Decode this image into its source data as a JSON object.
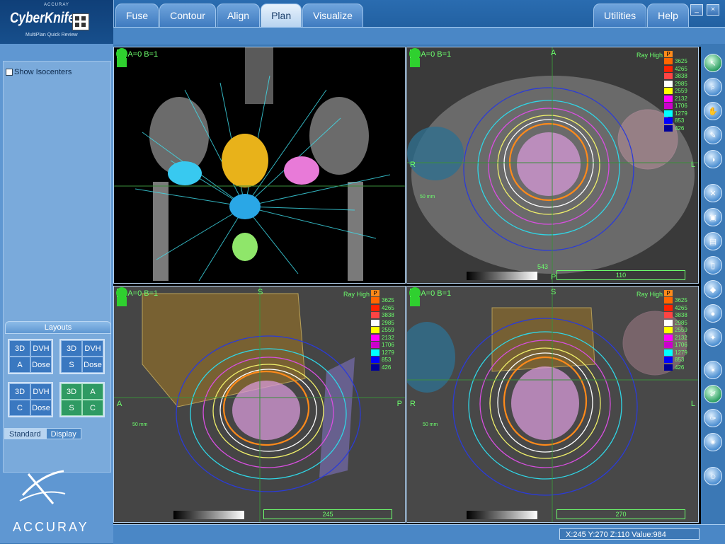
{
  "app": {
    "brand_top": "ACCURAY",
    "brand_name": "CyberKnife",
    "brand_sub": "MultiPlan Quick Review",
    "footer_brand": "ACCURAY"
  },
  "tabs": {
    "left": [
      {
        "label": "Fuse"
      },
      {
        "label": "Contour"
      },
      {
        "label": "Align"
      },
      {
        "label": "Plan",
        "active": true
      },
      {
        "label": "Visualize"
      }
    ],
    "right": [
      {
        "label": "Utilities"
      },
      {
        "label": "Help"
      }
    ]
  },
  "window_buttons": {
    "minimize": "_",
    "close": "×"
  },
  "left_panel": {
    "show_isocenters_label": "Show Isocenters",
    "show_isocenters_checked": false,
    "layouts_title": "Layouts",
    "layouts": [
      [
        "3D",
        "DVH",
        "A",
        "Dose"
      ],
      [
        "3D",
        "DVH",
        "S",
        "Dose"
      ],
      [
        "3D",
        "DVH",
        "C",
        "Dose"
      ],
      [
        "3D",
        "A",
        "S",
        "C"
      ]
    ],
    "mode_tabs": [
      "Standard",
      "Display"
    ],
    "selected_mode": "Standard"
  },
  "viewports": {
    "label": "A=0  B=1",
    "view_a_id": "A",
    "view_b_id": "B",
    "ray_high": "Ray High",
    "legend_header": "P",
    "isodose_levels": [
      {
        "value": "3625",
        "color": "#ff6600"
      },
      {
        "value": "4265",
        "color": "#ff2200"
      },
      {
        "value": "3838",
        "color": "#ff4444"
      },
      {
        "value": "2985",
        "color": "#ffffff"
      },
      {
        "value": "2559",
        "color": "#ffff00"
      },
      {
        "value": "2132",
        "color": "#ff00ff"
      },
      {
        "value": "1706",
        "color": "#cc00cc"
      },
      {
        "value": "1279",
        "color": "#00ffff"
      },
      {
        "value": "853",
        "color": "#0000ff"
      },
      {
        "value": "426",
        "color": "#000099"
      }
    ],
    "axial": {
      "top": "A",
      "bottom": "P",
      "left": "R",
      "right": "L",
      "slice": "110",
      "scale": "543",
      "ruler": "50 mm"
    },
    "sagittal": {
      "top": "S",
      "left": "A",
      "right": "P",
      "slice": "245",
      "ruler": "50 mm"
    },
    "coronal": {
      "top": "S",
      "left": "R",
      "right": "L",
      "slice": "270",
      "ruler": "50 mm"
    }
  },
  "status": {
    "coords": "X:245 Y:270 Z:110   Value:984"
  }
}
